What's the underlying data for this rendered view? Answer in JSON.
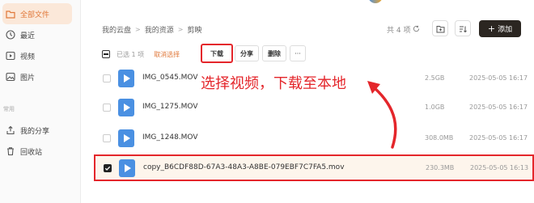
{
  "sidebar": {
    "items": [
      {
        "label": "全部文件",
        "icon": "folder-icon",
        "active": true
      },
      {
        "label": "最近",
        "icon": "clock-icon"
      },
      {
        "label": "视频",
        "icon": "video-icon"
      },
      {
        "label": "图片",
        "icon": "image-icon"
      }
    ],
    "section_label": "常用",
    "extra_items": [
      {
        "label": "我的分享",
        "icon": "share-icon"
      },
      {
        "label": "回收站",
        "icon": "trash-icon"
      }
    ]
  },
  "breadcrumb": [
    "我的云盘",
    "我的资源",
    "剪映"
  ],
  "item_count": "共 4 项",
  "add_label": "添加",
  "selection": {
    "selected_text": "已选 1 项",
    "clear_label": "取消选择"
  },
  "actions": {
    "download": "下载",
    "share": "分享",
    "delete": "删除",
    "more": "···"
  },
  "files": [
    {
      "name": "IMG_0545.MOV",
      "size": "2.5GB",
      "date": "2025-05-05 16:17",
      "selected": false
    },
    {
      "name": "IMG_1275.MOV",
      "size": "1.0GB",
      "date": "2025-05-05 16:17",
      "selected": false
    },
    {
      "name": "IMG_1248.MOV",
      "size": "308.0MB",
      "date": "2025-05-05 16:17",
      "selected": false
    },
    {
      "name": "copy_B6CDF88D-67A3-48A3-A8BE-079EBF7C7FA5.mov",
      "size": "230.3MB",
      "date": "2025-05-05 16:13",
      "selected": true
    }
  ],
  "annotation": "选择视频，下载至本地",
  "colors": {
    "accent": "#e0783a",
    "annotation": "#e4262b",
    "primary_button": "#2b2621",
    "video_thumb": "#4a90e2"
  }
}
